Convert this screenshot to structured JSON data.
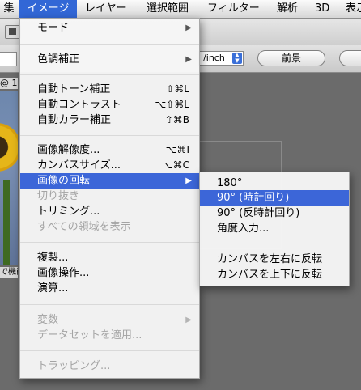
{
  "menubar": {
    "items": [
      {
        "label": "集"
      },
      {
        "label": "イメージ"
      },
      {
        "label": "レイヤー"
      },
      {
        "label": "選択範囲"
      },
      {
        "label": "フィルター"
      },
      {
        "label": "解析"
      },
      {
        "label": "3D"
      },
      {
        "label": "表示"
      }
    ],
    "active_index": 1
  },
  "options_bar": {
    "unit_select_value": "l/inch",
    "front_button_label": "前景"
  },
  "document": {
    "tab_label": "@ 1",
    "status_text": "で機能"
  },
  "image_menu": {
    "items": [
      {
        "label": "モード",
        "shortcut": "",
        "submenu": true,
        "enabled": true
      },
      {
        "label": "色調補正",
        "shortcut": "",
        "submenu": true,
        "enabled": true
      },
      {
        "label": "自動トーン補正",
        "shortcut": "⇧⌘L",
        "submenu": false,
        "enabled": true
      },
      {
        "label": "自動コントラスト",
        "shortcut": "⌥⇧⌘L",
        "submenu": false,
        "enabled": true
      },
      {
        "label": "自動カラー補正",
        "shortcut": "⇧⌘B",
        "submenu": false,
        "enabled": true
      },
      {
        "label": "画像解像度...",
        "shortcut": "⌥⌘I",
        "submenu": false,
        "enabled": true
      },
      {
        "label": "カンバスサイズ...",
        "shortcut": "⌥⌘C",
        "submenu": false,
        "enabled": true
      },
      {
        "label": "画像の回転",
        "shortcut": "",
        "submenu": true,
        "enabled": true,
        "highlighted": true
      },
      {
        "label": "切り抜き",
        "shortcut": "",
        "submenu": false,
        "enabled": false
      },
      {
        "label": "トリミング...",
        "shortcut": "",
        "submenu": false,
        "enabled": true
      },
      {
        "label": "すべての領域を表示",
        "shortcut": "",
        "submenu": false,
        "enabled": false
      },
      {
        "label": "複製...",
        "shortcut": "",
        "submenu": false,
        "enabled": true
      },
      {
        "label": "画像操作...",
        "shortcut": "",
        "submenu": false,
        "enabled": true
      },
      {
        "label": "演算...",
        "shortcut": "",
        "submenu": false,
        "enabled": true
      },
      {
        "label": "変数",
        "shortcut": "",
        "submenu": true,
        "enabled": false
      },
      {
        "label": "データセットを適用...",
        "shortcut": "",
        "submenu": false,
        "enabled": false
      },
      {
        "label": "トラッピング...",
        "shortcut": "",
        "submenu": false,
        "enabled": false
      }
    ]
  },
  "rotate_submenu": {
    "items": [
      {
        "label": "180°",
        "highlighted": false
      },
      {
        "label": "90° (時計回り)",
        "highlighted": true
      },
      {
        "label": "90° (反時計回り)",
        "highlighted": false
      },
      {
        "label": "角度入力...",
        "highlighted": false
      },
      {
        "label": "カンバスを左右に反転",
        "highlighted": false
      },
      {
        "label": "カンバスを上下に反転",
        "highlighted": false
      }
    ]
  },
  "colors": {
    "highlight": "#3c66d8",
    "menubar_active": "#3267d6",
    "disabled_text": "#a4a4a4"
  }
}
